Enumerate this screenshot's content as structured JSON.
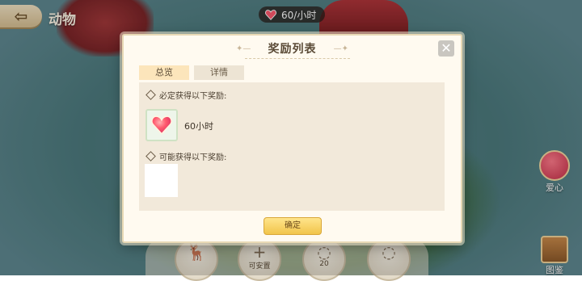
{
  "hud": {
    "back_icon": "back-arrow-icon",
    "page_title": "动物",
    "resource_icon": "heart-icon",
    "resource_text": "60/小时"
  },
  "side": {
    "love_label": "爱心",
    "guide_label": "图鉴"
  },
  "bottom": {
    "place_label": "可安置",
    "cost_value": "20"
  },
  "modal": {
    "title": "奖励列表",
    "close_icon": "close-icon",
    "tabs": [
      {
        "label": "总览",
        "active": true
      },
      {
        "label": "详情",
        "active": false
      }
    ],
    "guaranteed_label": "必定获得以下奖励:",
    "guaranteed_items": [
      {
        "icon": "heart-icon",
        "label": "60小时"
      }
    ],
    "possible_label": "可能获得以下奖励:",
    "confirm_label": "确定"
  },
  "colors": {
    "heart": "#ff5a6e",
    "confirm": "#f1c44a",
    "tab_active": "#fce5bb"
  }
}
